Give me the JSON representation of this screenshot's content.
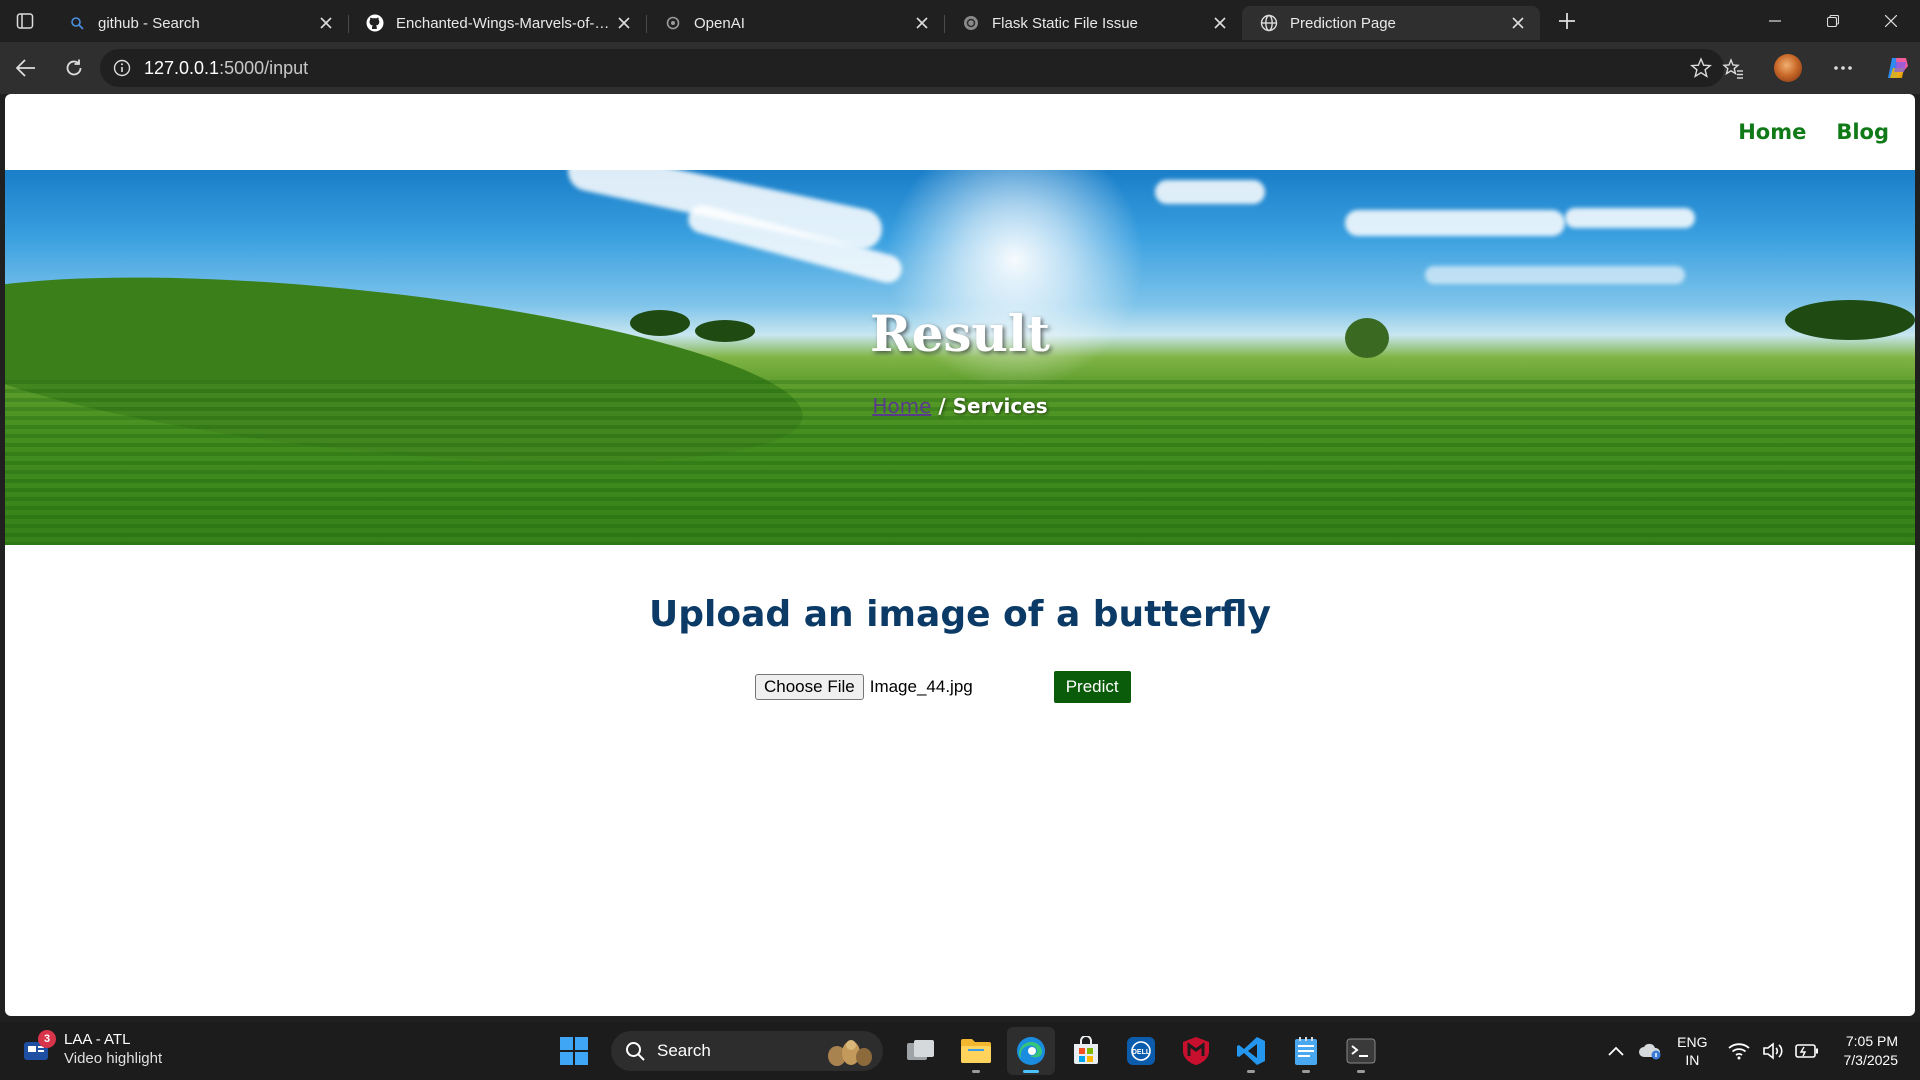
{
  "browser": {
    "tabs": [
      {
        "title": "github - Search",
        "icon": "search-icon"
      },
      {
        "title": "Enchanted-Wings-Marvels-of-Butterflies",
        "icon": "github-icon"
      },
      {
        "title": "OpenAI",
        "icon": "openai-icon"
      },
      {
        "title": "Flask Static File Issue",
        "icon": "openai-icon"
      },
      {
        "title": "Prediction Page",
        "icon": "globe-icon",
        "active": true
      }
    ],
    "url_host": "127.0.0.1",
    "url_path": ":5000/input"
  },
  "site": {
    "nav": {
      "home": "Home",
      "blog": "Blog"
    },
    "hero": {
      "title": "Result",
      "crumb_home": "Home",
      "crumb_sep": " / ",
      "crumb_current": "Services"
    },
    "upload": {
      "heading": "Upload an image of a butterfly",
      "file_button": "Choose File",
      "file_name": "Image_44.jpg",
      "predict_label": "Predict"
    },
    "colors": {
      "nav_link": "#0f7a17",
      "heading": "#0b3a66",
      "predict_bg": "#0a5c0a"
    }
  },
  "taskbar": {
    "widget": {
      "title": "LAA - ATL",
      "subtitle": "Video highlight",
      "badge": "3"
    },
    "search_label": "Search",
    "language": {
      "line1": "ENG",
      "line2": "IN"
    },
    "clock": {
      "time": "7:05 PM",
      "date": "7/3/2025"
    }
  }
}
